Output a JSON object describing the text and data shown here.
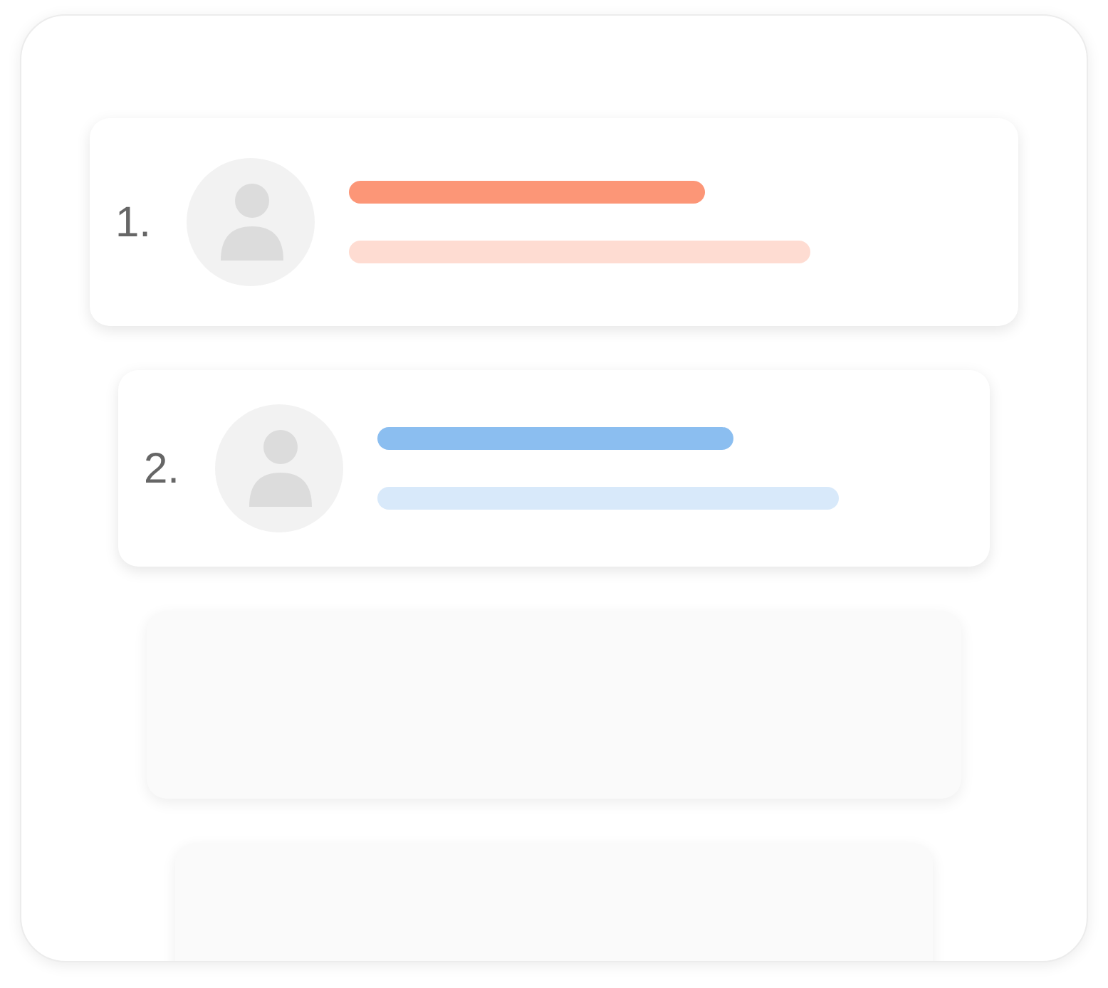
{
  "cards": [
    {
      "kind": "entry",
      "number": "1.",
      "color": "#fc9677"
    },
    {
      "kind": "entry",
      "number": "2.",
      "color": "#8bbef0"
    },
    {
      "kind": "blank"
    },
    {
      "kind": "blank"
    }
  ]
}
